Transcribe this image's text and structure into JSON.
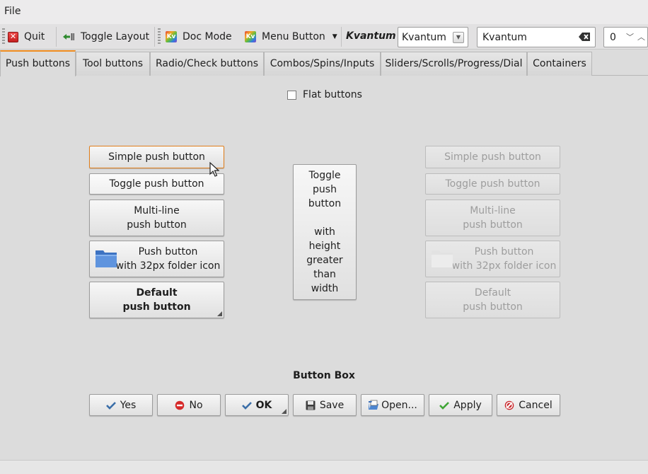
{
  "menubar": {
    "file_label": "File"
  },
  "toolbar": {
    "quit_label": "Quit",
    "toggle_layout_label": "Toggle Layout",
    "doc_mode_label": "Doc Mode",
    "menu_button_label": "Menu Button",
    "kvantum_label": "Kvantum",
    "combo_value": "Kvantum",
    "line_edit_value": "Kvantum",
    "spin_value": "0"
  },
  "tabs": [
    {
      "label": "Push buttons"
    },
    {
      "label": "Tool buttons"
    },
    {
      "label": "Radio/Check buttons"
    },
    {
      "label": "Combos/Spins/Inputs"
    },
    {
      "label": "Sliders/Scrolls/Progress/Dial"
    },
    {
      "label": "Containers"
    }
  ],
  "flat_buttons_label": "Flat buttons",
  "left_buttons": {
    "simple": "Simple push button",
    "toggle": "Toggle push button",
    "multi_line": "Multi-line\npush button",
    "folder_icon": "Push button\nwith 32px folder icon",
    "default": "Default\npush button"
  },
  "center_toggle": "Toggle\npush\nbutton\n\nwith\nheight\ngreater\nthan\nwidth",
  "right_buttons": {
    "simple": "Simple push button",
    "toggle": "Toggle push button",
    "multi_line": "Multi-line\npush button",
    "folder_icon": "Push button\nwith 32px folder icon",
    "default": "Default\npush button"
  },
  "button_box": {
    "title": "Button Box",
    "yes": "Yes",
    "no": "No",
    "ok": "OK",
    "save": "Save",
    "open": "Open...",
    "apply": "Apply",
    "cancel": "Cancel"
  },
  "colors": {
    "accent": "#f08c1e",
    "window_bg": "#dcdcdc",
    "disabled_text": "#9d9d9d",
    "check_blue": "#3a6ea8",
    "no_red": "#d62a2a",
    "apply_green": "#3fa535"
  },
  "icons": {
    "quit": "close-box-icon",
    "toggle_layout": "toggle-layout-icon",
    "doc_mode": "kvantum-icon",
    "menu_button": "kvantum-icon",
    "combo_arrow": "chevron-down-icon",
    "clear": "clear-text-icon",
    "folder": "folder-icon",
    "yes": "check-icon",
    "ok": "check-icon",
    "no": "no-entry-icon",
    "save": "floppy-icon",
    "open": "open-file-icon",
    "apply": "check-icon",
    "cancel": "cancel-icon"
  }
}
